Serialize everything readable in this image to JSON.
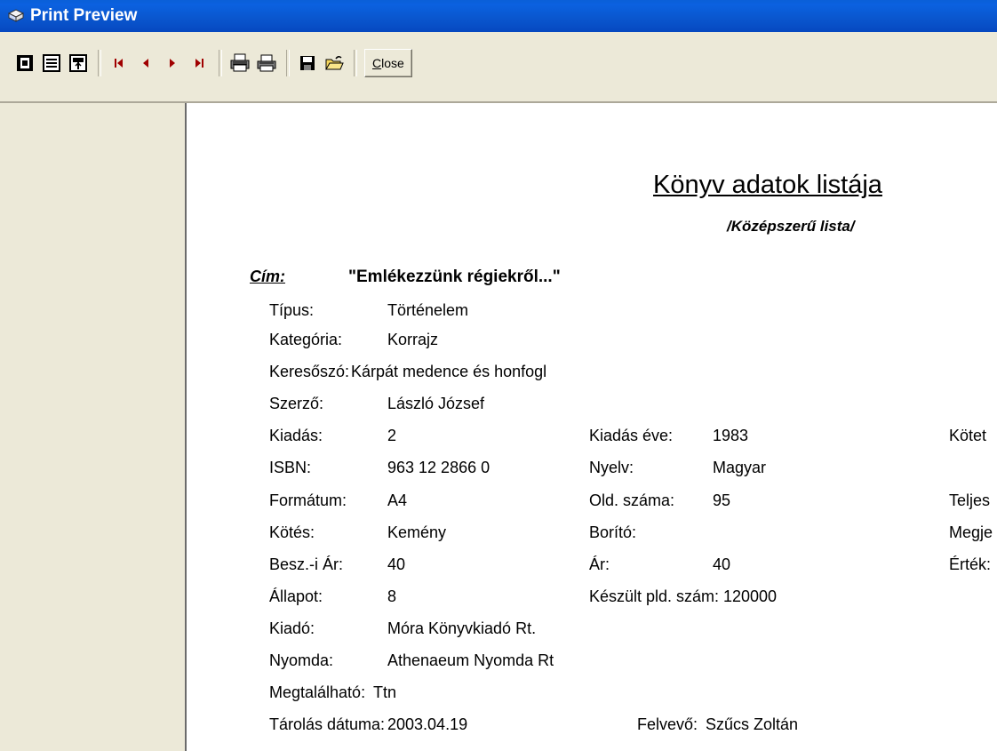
{
  "window": {
    "title": "Print Preview"
  },
  "toolbar": {
    "buttons": [
      {
        "name": "one-page-icon"
      },
      {
        "name": "two-pages-icon"
      },
      {
        "name": "zoom-page-icon"
      },
      {
        "name": "first-page-icon"
      },
      {
        "name": "previous-page-icon"
      },
      {
        "name": "next-page-icon"
      },
      {
        "name": "last-page-icon"
      },
      {
        "name": "print-setup-icon"
      },
      {
        "name": "print-icon"
      },
      {
        "name": "save-icon"
      },
      {
        "name": "open-icon"
      }
    ],
    "close_label_mnemonic": "C",
    "close_label_rest": "lose"
  },
  "report": {
    "title": "Könyv adatok listája",
    "subtitle": "/Középszerű lista/",
    "cim_label": "Cím:",
    "cim_value": "\"Emlékezzünk régiekről...\"",
    "fields": {
      "tipus": {
        "label": "Típus:",
        "value": "Történelem"
      },
      "kategoria": {
        "label": "Kategória:",
        "value": "Korrajz"
      },
      "keresoszo": {
        "label": "Keresőszó:",
        "value": "Kárpát medence és honfogl"
      },
      "szerzo": {
        "label": "Szerző:",
        "value": "László József"
      },
      "kiadas": {
        "label": "Kiadás:",
        "value": "2"
      },
      "kiadas_eve": {
        "label": "Kiadás éve:",
        "value": "1983"
      },
      "kotet": {
        "label": "Kötet"
      },
      "isbn": {
        "label": "ISBN:",
        "value": "963 12 2866 0"
      },
      "nyelv": {
        "label": "Nyelv:",
        "value": "Magyar"
      },
      "formatum": {
        "label": "Formátum:",
        "value": "A4"
      },
      "old_szama": {
        "label": "Old. száma:",
        "value": "95"
      },
      "teljes": {
        "label": "Teljes"
      },
      "kotes": {
        "label": "Kötés:",
        "value": "Kemény"
      },
      "borito": {
        "label": "Borító:"
      },
      "megje": {
        "label": "Megje"
      },
      "besz_ar": {
        "label": "Besz.-i Ár:",
        "value": "40"
      },
      "ar": {
        "label": "Ár:",
        "value": "40"
      },
      "ertek": {
        "label": "Érték:"
      },
      "allapot": {
        "label": "Állapot:",
        "value": "8"
      },
      "keszult": {
        "label": "Készült pld. szám:",
        "value": "120000"
      },
      "kiado": {
        "label": "Kiadó:",
        "value": "Móra Könyvkiadó Rt."
      },
      "nyomda": {
        "label": "Nyomda:",
        "value": "Athenaeum Nyomda Rt"
      },
      "megtalalhato": {
        "label": "Megtalálható:",
        "value": "Ttn"
      },
      "tarolas": {
        "label": "Tárolás dátuma:",
        "value": "2003.04.19"
      },
      "felvevo": {
        "label": "Felvevő:",
        "value": "Szűcs Zoltán"
      }
    }
  }
}
